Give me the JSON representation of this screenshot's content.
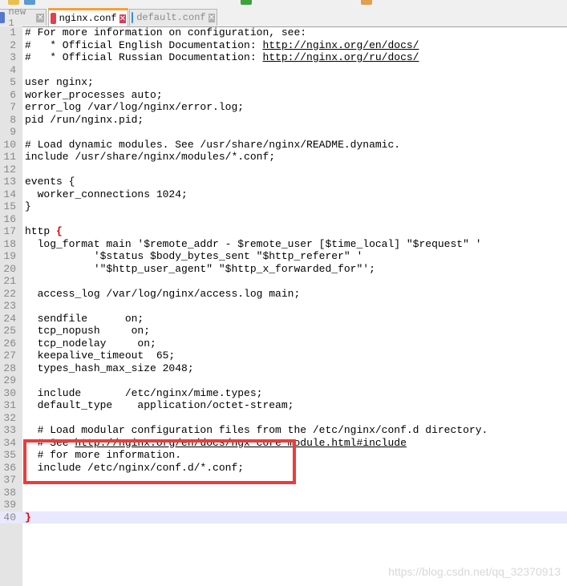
{
  "tabs": [
    {
      "label": "new 1",
      "active": false,
      "color": "#5577cc"
    },
    {
      "label": "nginx.conf",
      "active": true,
      "color": "#e04050"
    },
    {
      "label": "default.conf",
      "active": false,
      "color": "#3b8fd0"
    }
  ],
  "lines": [
    "# For more information on configuration, see:",
    "#   * Official English Documentation: |http://nginx.org/en/docs/",
    "#   * Official Russian Documentation: |http://nginx.org/ru/docs/",
    "",
    "user nginx;",
    "worker_processes auto;",
    "error_log /var/log/nginx/error.log;",
    "pid /run/nginx.pid;",
    "",
    "# Load dynamic modules. See /usr/share/nginx/README.dynamic.",
    "include /usr/share/nginx/modules/*.conf;",
    "",
    "events {",
    "  worker_connections 1024;",
    "}",
    "",
    "http {",
    "  log_format main '$remote_addr - $remote_user [$time_local] \"$request\" '",
    "           '$status $body_bytes_sent \"$http_referer\" '",
    "           '\"$http_user_agent\" \"$http_x_forwarded_for\"';",
    "",
    "  access_log /var/log/nginx/access.log main;",
    "",
    "  sendfile      on;",
    "  tcp_nopush     on;",
    "  tcp_nodelay     on;",
    "  keepalive_timeout  65;",
    "  types_hash_max_size 2048;",
    "",
    "  include       /etc/nginx/mime.types;",
    "  default_type    application/octet-stream;",
    "",
    "  # Load modular configuration files from the /etc/nginx/conf.d directory.",
    "  # See |http://nginx.org/en/docs/ngx_core_module.html#include",
    "  # for more information.",
    "  include /etc/nginx/conf.d/*.conf;",
    "",
    "",
    "",
    "}"
  ],
  "watermark": "https://blog.csdn.net/qq_32370913",
  "highlight_color": "#f03a3a"
}
